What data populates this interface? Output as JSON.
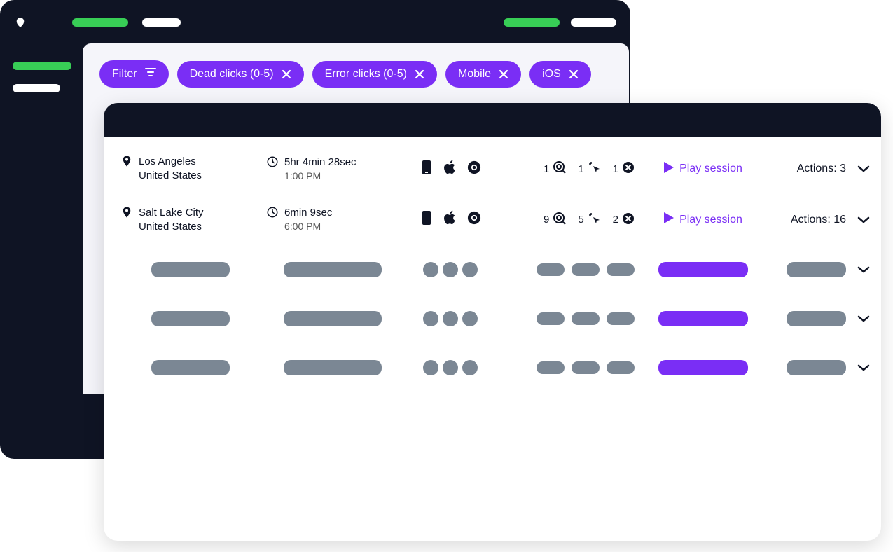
{
  "colors": {
    "accent": "#7A2EF5",
    "success": "#38CE56",
    "dark": "#0F1424",
    "muted": "#7B8794"
  },
  "filters": {
    "filter_label": "Filter",
    "chips": [
      {
        "label": "Dead clicks (0-5)"
      },
      {
        "label": "Error clicks (0-5)"
      },
      {
        "label": "Mobile"
      },
      {
        "label": "iOS"
      }
    ]
  },
  "sessions": [
    {
      "city": "Los Angeles",
      "country": "United States",
      "duration": "5hr 4min 28sec",
      "time": "1:00 PM",
      "dead_clicks": 1,
      "rage_clicks": 1,
      "error_clicks": 1,
      "play_label": "Play session",
      "actions_label": "Actions: 3"
    },
    {
      "city": "Salt Lake City",
      "country": "United States",
      "duration": "6min 9sec",
      "time": "6:00 PM",
      "dead_clicks": 9,
      "rage_clicks": 5,
      "error_clicks": 2,
      "play_label": "Play session",
      "actions_label": "Actions: 16"
    }
  ],
  "skeleton_row_count": 3
}
